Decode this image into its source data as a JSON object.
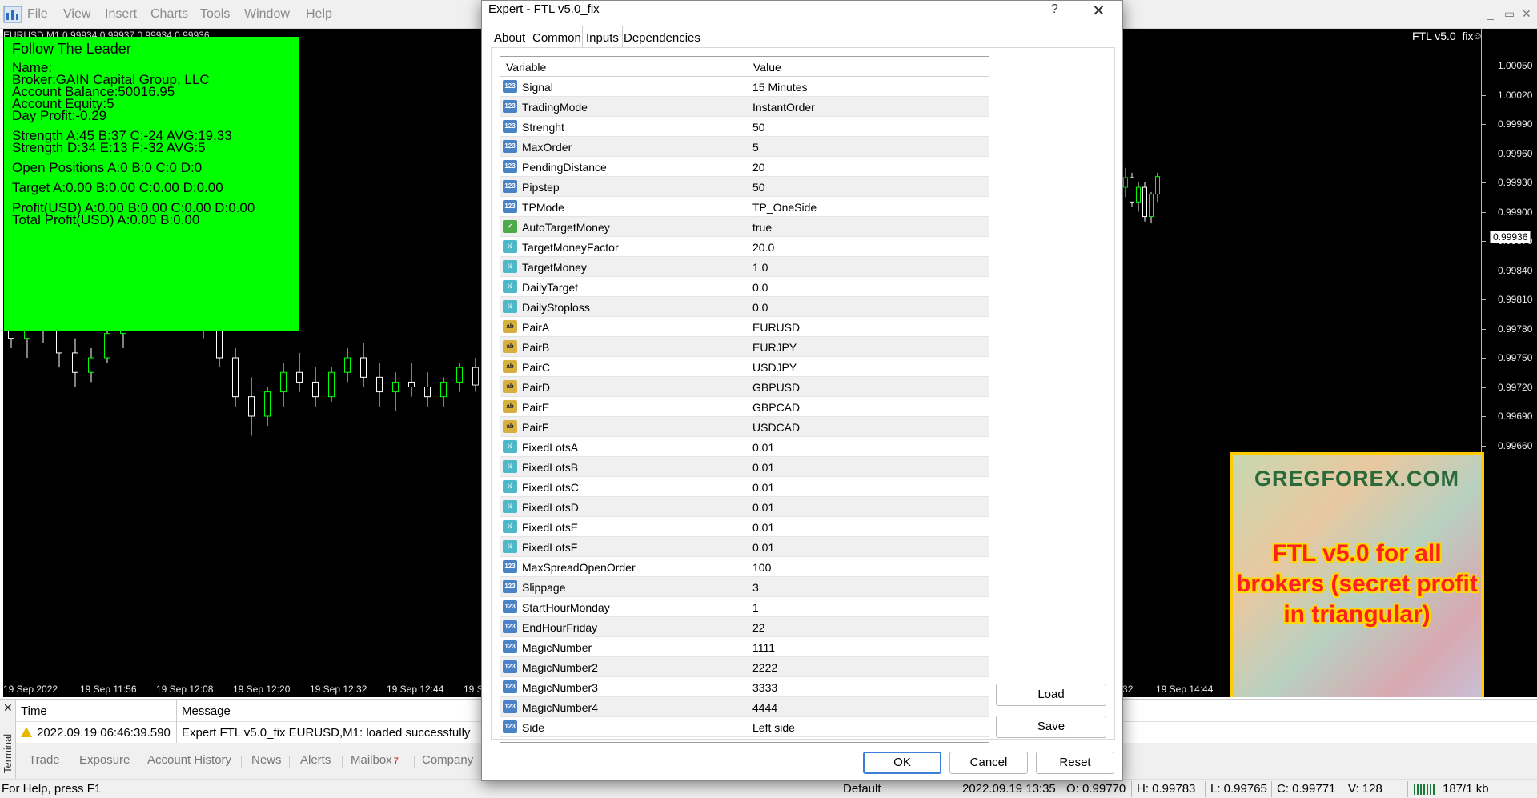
{
  "app": {
    "menus": [
      "File",
      "View",
      "Insert",
      "Charts",
      "Tools",
      "Window",
      "Help"
    ],
    "window_controls": [
      "_",
      "▭",
      "✕"
    ]
  },
  "chart": {
    "title": "EURUSD,M1  0.99934 0.99937 0.99934 0.99936",
    "ea_label": "FTL v5.0_fix",
    "candle_colors": {
      "up": "#00ff00",
      "down": "#ffffff",
      "line": "#ffffff"
    },
    "price_ticks": [
      "1.00050",
      "1.00020",
      "0.99990",
      "0.99960",
      "0.99930",
      "0.99900",
      "0.99870",
      "0.99840",
      "0.99810",
      "0.99780",
      "0.99750",
      "0.99720",
      "0.99690",
      "0.99660"
    ],
    "current_price": "0.99936",
    "time_labels": [
      "19 Sep 2022",
      "19 Sep 11:56",
      "19 Sep 12:08",
      "19 Sep 12:20",
      "19 Sep 12:32",
      "19 Sep 12:44",
      "19 Sep 12:56",
      "19 Sep 14:32",
      "19 Sep 14:44"
    ],
    "series": [
      {
        "o": 0.9979,
        "h": 0.99805,
        "l": 0.9976,
        "c": 0.9977
      },
      {
        "o": 0.9977,
        "h": 0.9979,
        "l": 0.9975,
        "c": 0.9978
      },
      {
        "o": 0.9978,
        "h": 0.998,
        "l": 0.99765,
        "c": 0.9979
      },
      {
        "o": 0.9979,
        "h": 0.998,
        "l": 0.9974,
        "c": 0.99755
      },
      {
        "o": 0.99755,
        "h": 0.9977,
        "l": 0.9972,
        "c": 0.99735
      },
      {
        "o": 0.99735,
        "h": 0.9976,
        "l": 0.99725,
        "c": 0.9975
      },
      {
        "o": 0.9975,
        "h": 0.9978,
        "l": 0.99745,
        "c": 0.99775
      },
      {
        "o": 0.99775,
        "h": 0.998,
        "l": 0.9976,
        "c": 0.99795
      },
      {
        "o": 0.99795,
        "h": 0.9982,
        "l": 0.9978,
        "c": 0.9981
      },
      {
        "o": 0.9981,
        "h": 0.9984,
        "l": 0.998,
        "c": 0.9983
      },
      {
        "o": 0.9983,
        "h": 0.9986,
        "l": 0.9981,
        "c": 0.99815
      },
      {
        "o": 0.99815,
        "h": 0.9983,
        "l": 0.9979,
        "c": 0.998
      },
      {
        "o": 0.998,
        "h": 0.9981,
        "l": 0.9977,
        "c": 0.9978
      },
      {
        "o": 0.9978,
        "h": 0.9979,
        "l": 0.9974,
        "c": 0.9975
      },
      {
        "o": 0.9975,
        "h": 0.9976,
        "l": 0.997,
        "c": 0.9971
      },
      {
        "o": 0.9971,
        "h": 0.9973,
        "l": 0.9967,
        "c": 0.9969
      },
      {
        "o": 0.9969,
        "h": 0.9972,
        "l": 0.9968,
        "c": 0.99715
      },
      {
        "o": 0.99715,
        "h": 0.99745,
        "l": 0.997,
        "c": 0.99735
      },
      {
        "o": 0.99735,
        "h": 0.99755,
        "l": 0.99715,
        "c": 0.99725
      },
      {
        "o": 0.99725,
        "h": 0.9974,
        "l": 0.997,
        "c": 0.9971
      },
      {
        "o": 0.9971,
        "h": 0.9974,
        "l": 0.99705,
        "c": 0.99735
      },
      {
        "o": 0.99735,
        "h": 0.9976,
        "l": 0.99725,
        "c": 0.9975
      },
      {
        "o": 0.9975,
        "h": 0.99765,
        "l": 0.9972,
        "c": 0.9973
      },
      {
        "o": 0.9973,
        "h": 0.99745,
        "l": 0.997,
        "c": 0.99715
      },
      {
        "o": 0.99715,
        "h": 0.99735,
        "l": 0.99695,
        "c": 0.99725
      },
      {
        "o": 0.99725,
        "h": 0.99745,
        "l": 0.9971,
        "c": 0.9972
      },
      {
        "o": 0.9972,
        "h": 0.99735,
        "l": 0.997,
        "c": 0.9971
      },
      {
        "o": 0.9971,
        "h": 0.9973,
        "l": 0.997,
        "c": 0.99725
      },
      {
        "o": 0.99725,
        "h": 0.99745,
        "l": 0.99715,
        "c": 0.9974
      },
      {
        "o": 0.9974,
        "h": 0.9975,
        "l": 0.99715,
        "c": 0.99722
      }
    ],
    "right_series": [
      {
        "o": 0.99925,
        "h": 0.99945,
        "l": 0.99915,
        "c": 0.99935
      },
      {
        "o": 0.99935,
        "h": 0.9994,
        "l": 0.99905,
        "c": 0.9991
      },
      {
        "o": 0.9991,
        "h": 0.9993,
        "l": 0.999,
        "c": 0.99925
      },
      {
        "o": 0.99925,
        "h": 0.9993,
        "l": 0.9989,
        "c": 0.99895
      },
      {
        "o": 0.99895,
        "h": 0.9992,
        "l": 0.99888,
        "c": 0.99918
      },
      {
        "o": 0.99918,
        "h": 0.9994,
        "l": 0.9991,
        "c": 0.99936
      }
    ]
  },
  "info_panel": {
    "lines": [
      "Name:",
      "Broker:GAIN Capital Group, LLC",
      "Account Balance:50016.95",
      "Account Equity:5",
      "Day Profit:-0.29",
      "",
      "Strength A:45 B:37 C:-24 AVG:19.33",
      "Strength D:34 E:13 F:-32 AVG:5",
      "",
      "Open Positions A:0 B:0 C:0 D:0",
      "",
      "Target A:0.00 B:0.00 C:0.00 D:0.00",
      "",
      "Profit(USD) A:0.00 B:0.00 C:0.00 D:0.00",
      "Total Profit(USD) A:0.00 B:0.00"
    ],
    "title": "Follow The Leader",
    "color": "#00ff00"
  },
  "banner": {
    "site": "GREGFOREX.COM",
    "text": "FTL v5.0 for all brokers (secret profit in triangular)",
    "border_color": "#ffcc00"
  },
  "terminal": {
    "side_label": "Terminal",
    "close": "✕",
    "columns": [
      "Time",
      "Message"
    ],
    "rows": [
      {
        "time": "2022.09.19 06:46:39.590",
        "message": "Expert FTL v5.0_fix EURUSD,M1: loaded successfully"
      }
    ],
    "tabs": [
      "Trade",
      "Exposure",
      "Account History",
      "News",
      "Alerts",
      "Mailbox",
      "Company"
    ],
    "mailbox_badge": "7"
  },
  "status_bar": {
    "help": "For Help, press F1",
    "profile": "Default",
    "datetime": "2022.09.19 13:35",
    "open": "O: 0.99770",
    "high": "H: 0.99783",
    "low": "L: 0.99765",
    "close": "C: 0.99771",
    "volume": "V: 128",
    "traffic": "187/1 kb"
  },
  "dialog": {
    "title": "Expert - FTL v5.0_fix",
    "help": "?",
    "close": "✕",
    "tabs": [
      "About",
      "Common",
      "Inputs",
      "Dependencies"
    ],
    "active_tab": "Inputs",
    "columns": {
      "variable": "Variable",
      "value": "Value"
    },
    "params": [
      {
        "type": "int",
        "icon": "123",
        "name": "Signal",
        "value": "15 Minutes"
      },
      {
        "type": "int",
        "icon": "123",
        "name": "TradingMode",
        "value": "InstantOrder"
      },
      {
        "type": "int",
        "icon": "123",
        "name": "Strenght",
        "value": "50"
      },
      {
        "type": "int",
        "icon": "123",
        "name": "MaxOrder",
        "value": "5"
      },
      {
        "type": "int",
        "icon": "123",
        "name": "PendingDistance",
        "value": "20"
      },
      {
        "type": "int",
        "icon": "123",
        "name": "Pipstep",
        "value": "50"
      },
      {
        "type": "int",
        "icon": "123",
        "name": "TPMode",
        "value": "TP_OneSide"
      },
      {
        "type": "bool",
        "icon": "✓",
        "name": "AutoTargetMoney",
        "value": "true"
      },
      {
        "type": "dbl",
        "icon": "½",
        "name": "TargetMoneyFactor",
        "value": "20.0"
      },
      {
        "type": "dbl",
        "icon": "½",
        "name": "TargetMoney",
        "value": "1.0"
      },
      {
        "type": "dbl",
        "icon": "½",
        "name": "DailyTarget",
        "value": "0.0"
      },
      {
        "type": "dbl",
        "icon": "½",
        "name": "DailyStoploss",
        "value": "0.0"
      },
      {
        "type": "str",
        "icon": "ab",
        "name": "PairA",
        "value": "EURUSD"
      },
      {
        "type": "str",
        "icon": "ab",
        "name": "PairB",
        "value": "EURJPY"
      },
      {
        "type": "str",
        "icon": "ab",
        "name": "PairC",
        "value": "USDJPY"
      },
      {
        "type": "str",
        "icon": "ab",
        "name": "PairD",
        "value": "GBPUSD"
      },
      {
        "type": "str",
        "icon": "ab",
        "name": "PairE",
        "value": "GBPCAD"
      },
      {
        "type": "str",
        "icon": "ab",
        "name": "PairF",
        "value": "USDCAD"
      },
      {
        "type": "dbl",
        "icon": "½",
        "name": "FixedLotsA",
        "value": "0.01"
      },
      {
        "type": "dbl",
        "icon": "½",
        "name": "FixedLotsB",
        "value": "0.01"
      },
      {
        "type": "dbl",
        "icon": "½",
        "name": "FixedLotsC",
        "value": "0.01"
      },
      {
        "type": "dbl",
        "icon": "½",
        "name": "FixedLotsD",
        "value": "0.01"
      },
      {
        "type": "dbl",
        "icon": "½",
        "name": "FixedLotsE",
        "value": "0.01"
      },
      {
        "type": "dbl",
        "icon": "½",
        "name": "FixedLotsF",
        "value": "0.01"
      },
      {
        "type": "int",
        "icon": "123",
        "name": "MaxSpreadOpenOrder",
        "value": "100"
      },
      {
        "type": "int",
        "icon": "123",
        "name": "Slippage",
        "value": "3"
      },
      {
        "type": "int",
        "icon": "123",
        "name": "StartHourMonday",
        "value": "1"
      },
      {
        "type": "int",
        "icon": "123",
        "name": "EndHourFriday",
        "value": "22"
      },
      {
        "type": "int",
        "icon": "123",
        "name": "MagicNumber",
        "value": "1111"
      },
      {
        "type": "int",
        "icon": "123",
        "name": "MagicNumber2",
        "value": "2222"
      },
      {
        "type": "int",
        "icon": "123",
        "name": "MagicNumber3",
        "value": "3333"
      },
      {
        "type": "int",
        "icon": "123",
        "name": "MagicNumber4",
        "value": "4444"
      },
      {
        "type": "int",
        "icon": "123",
        "name": "Side",
        "value": "Left side"
      }
    ],
    "buttons": {
      "load": "Load",
      "save": "Save",
      "ok": "OK",
      "cancel": "Cancel",
      "reset": "Reset"
    }
  }
}
